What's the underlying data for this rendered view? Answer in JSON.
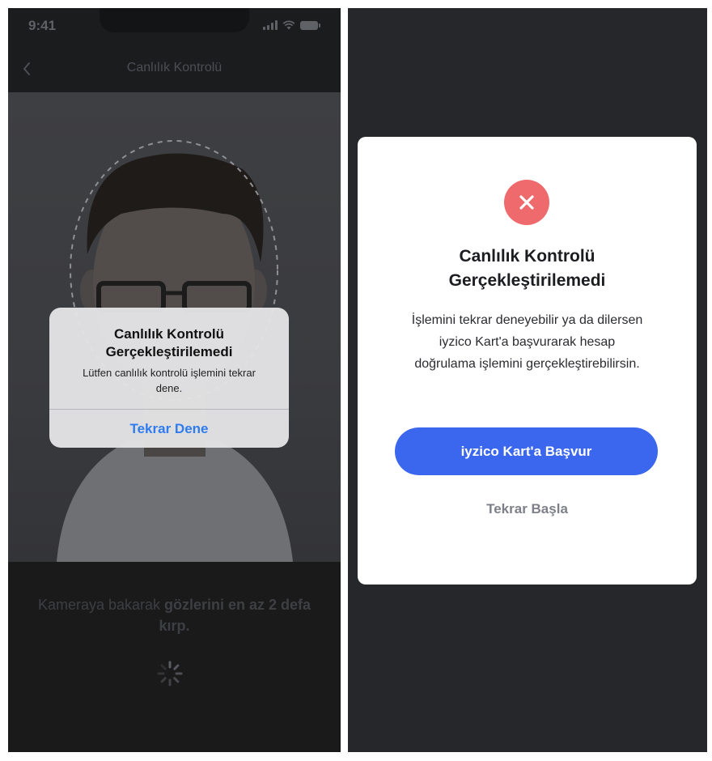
{
  "left_screen": {
    "status_bar": {
      "time": "9:41"
    },
    "nav": {
      "title": "Canlılık Kontrolü"
    },
    "alert": {
      "title_line1": "Canlılık Kontrolü",
      "title_line2": "Gerçekleştirilemedi",
      "message_line1": "Lütfen canlılık kontrolü işlemini tekrar",
      "message_line2": "dene.",
      "button_label": "Tekrar Dene"
    },
    "instruction": {
      "prefix": "Kameraya bakarak ",
      "bold_line1": "gözlerini en az 2 defa",
      "bold_line2": "kırp."
    }
  },
  "right_screen": {
    "modal": {
      "icon": "close-icon",
      "title_line1": "Canlılık Kontrolü",
      "title_line2": "Gerçekleştirilemedi",
      "desc_line1": "İşlemini tekrar deneyebilir ya da dilersen",
      "desc_line2": "iyzico Kart'a başvurarak hesap",
      "desc_line3": "doğrulama işlemini gerçekleştirebilirsin.",
      "primary_button": "iyzico Kart'a Başvur",
      "secondary_button": "Tekrar Başla"
    }
  },
  "colors": {
    "primary": "#3b66ee",
    "error": "#ee6a6c",
    "ios_link": "#2f7cf0"
  }
}
